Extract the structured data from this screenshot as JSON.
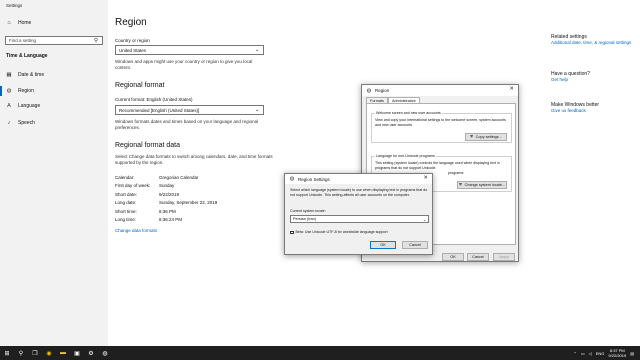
{
  "settings": {
    "window_title": "Settings",
    "home": "Home",
    "search_placeholder": "Find a setting",
    "section": "Time & Language",
    "items": [
      {
        "label": "Date & time",
        "icon": "calendar-icon"
      },
      {
        "label": "Region",
        "icon": "globe-icon",
        "selected": true
      },
      {
        "label": "Language",
        "icon": "language-icon"
      },
      {
        "label": "Speech",
        "icon": "microphone-icon"
      }
    ]
  },
  "main": {
    "title": "Region",
    "country_label": "Country or region",
    "country_value": "United States",
    "country_desc": "Windows and apps might use your country or region to give you local content.",
    "regional_format_heading": "Regional format",
    "current_format": "Current format: English (United States)",
    "format_value": "Recommended [English (United States)]",
    "format_desc": "Windows formats dates and times based on your language and regional preferences.",
    "format_data_heading": "Regional format data",
    "format_data_desc": "Select Change data formats to switch among calendars, date, and time formats supported by the region.",
    "format_rows": [
      {
        "k": "Calendar:",
        "v": "Gregorian Calendar"
      },
      {
        "k": "First day of week:",
        "v": "Sunday"
      },
      {
        "k": "Short date:",
        "v": "9/22/2019"
      },
      {
        "k": "Long date:",
        "v": "Sunday, September 22, 2019"
      },
      {
        "k": "Short time:",
        "v": "8:36 PM"
      },
      {
        "k": "Long time:",
        "v": "8:36:24 PM"
      }
    ],
    "change_formats_link": "Change data formats"
  },
  "right": {
    "related_heading": "Related settings",
    "related_link": "Additional date, time, & regional settings",
    "question_heading": "Have a question?",
    "question_link": "Get help",
    "better_heading": "Make Windows better",
    "better_link": "Give us feedback"
  },
  "region_dialog": {
    "title": "Region",
    "tabs": [
      "Formats",
      "Administrative"
    ],
    "welcome_group": "Welcome screen and new user accounts",
    "welcome_text": "View and copy your international settings to the welcome screen, system accounts and new user accounts.",
    "copy_button": "Copy settings...",
    "unicode_group": "Language for non-Unicode programs",
    "unicode_text": "This setting (system locale) controls the language used when displaying text in programs that do not support Unicode.",
    "unicode_partial": "programs:",
    "change_locale_button": "Change system locale...",
    "ok": "OK",
    "cancel": "Cancel",
    "apply": "Apply"
  },
  "region_settings_dialog": {
    "title": "Region Settings",
    "description": "Select which language (system locale) to use when displaying text in programs that do not support Unicode. This setting affects all user accounts on the computer.",
    "locale_label": "Current system locale:",
    "locale_value": "Persian (Iran)",
    "beta_label": "Beta: Use Unicode UTF-8 for worldwide language support",
    "ok": "OK",
    "cancel": "Cancel"
  },
  "taskbar": {
    "language": "ENG",
    "time": "8:37 PM",
    "date": "9/22/2019"
  },
  "colors": {
    "accent": "#0067c0",
    "taskbar": "#1f1f1f",
    "sidebar": "#f2f2f2"
  }
}
